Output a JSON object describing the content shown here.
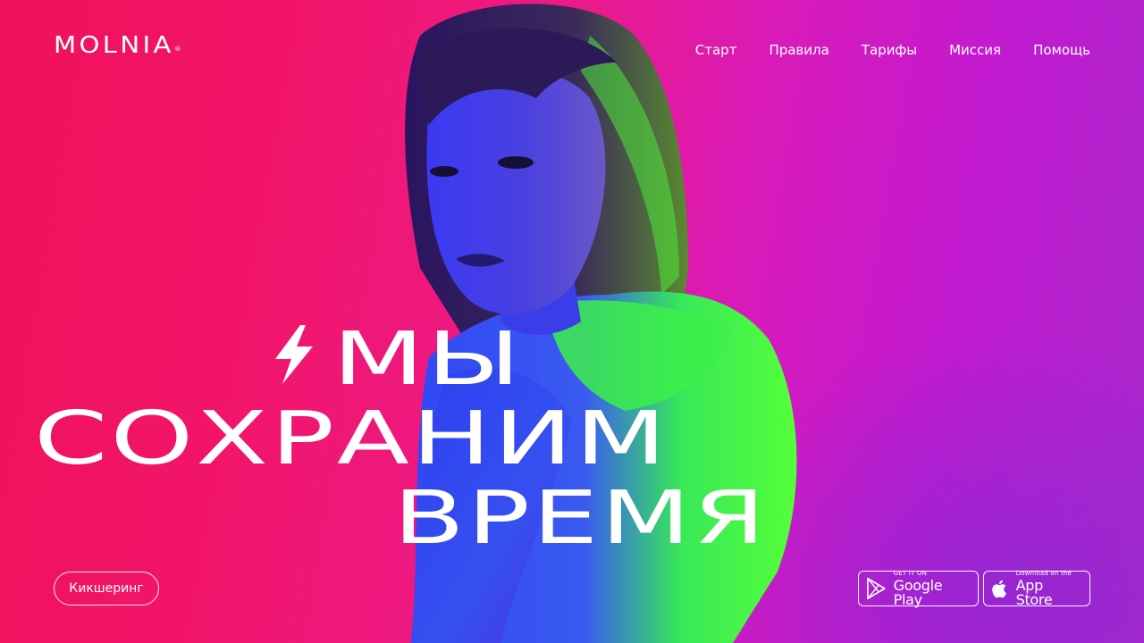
{
  "brand": {
    "logo_text": "MOLNIA",
    "registered_mark": "®"
  },
  "nav": {
    "items": [
      {
        "label": "Старт"
      },
      {
        "label": "Правила"
      },
      {
        "label": "Тарифы"
      },
      {
        "label": "Миссия"
      },
      {
        "label": "Помощь"
      }
    ]
  },
  "hero": {
    "line1": "МЫ",
    "line2": "СОХРАНИМ",
    "line3": "ВРЕМЯ",
    "bolt_icon": "lightning-bolt-icon"
  },
  "cta": {
    "kicksharing_label": "Кикшеринг"
  },
  "stores": {
    "google_play": {
      "small": "GET IT ON",
      "big": "Google Play",
      "icon": "google-play-icon"
    },
    "app_store": {
      "small": "Download on the",
      "big": "App Store",
      "icon": "apple-icon"
    }
  },
  "colors": {
    "background_left": "#f0125a",
    "background_right": "#a928cc",
    "light_green": "#39ff3a",
    "light_blue": "#2b3df0",
    "text": "#ffffff"
  }
}
